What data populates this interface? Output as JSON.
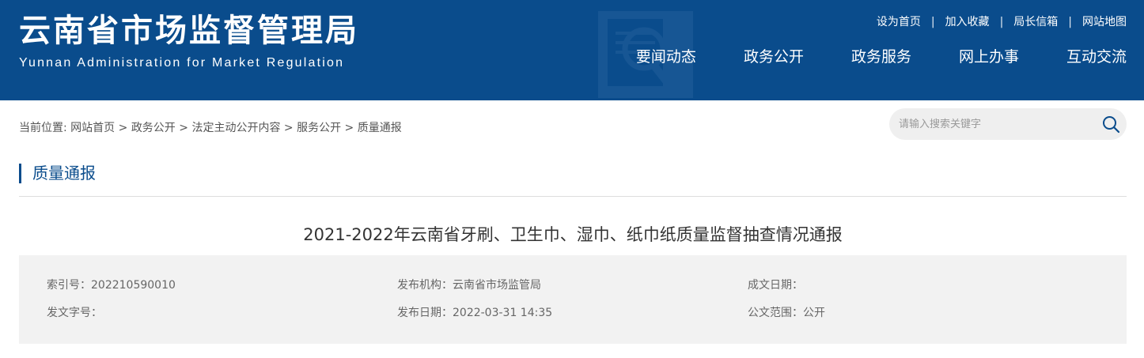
{
  "header": {
    "site_title": "云南省市场监督管理局",
    "site_subtitle": "Yunnan Administration for Market Regulation",
    "top_links": [
      "设为首页",
      "加入收藏",
      "局长信箱",
      "网站地图"
    ],
    "top_link_separator": "|",
    "nav": [
      "要闻动态",
      "政务公开",
      "政务服务",
      "网上办事",
      "互动交流"
    ],
    "colors": {
      "brand": "#0a4c8c",
      "emblem": "#2f6aa3"
    }
  },
  "breadcrumb": {
    "prefix": "当前位置:",
    "items": [
      "网站首页",
      "政务公开",
      "法定主动公开内容",
      "服务公开",
      "质量通报"
    ],
    "separator": ">"
  },
  "search": {
    "placeholder": "请输入搜索关键字",
    "icon": "search-icon"
  },
  "section": {
    "title": "质量通报"
  },
  "article": {
    "title": "2021-2022年云南省牙刷、卫生巾、湿巾、纸巾纸质量监督抽查情况通报",
    "meta": {
      "index_label": "索引号：",
      "index_value": "202210590010",
      "issuer_label": "发布机构：",
      "issuer_value": "云南省市场监管局",
      "written_date_label": "成文日期：",
      "written_date_value": "",
      "doc_no_label": "发文字号：",
      "doc_no_value": "",
      "publish_date_label": "发布日期：",
      "publish_date_value": "2022-03-31 14:35",
      "scope_label": "公文范围：",
      "scope_value": "公开"
    }
  }
}
